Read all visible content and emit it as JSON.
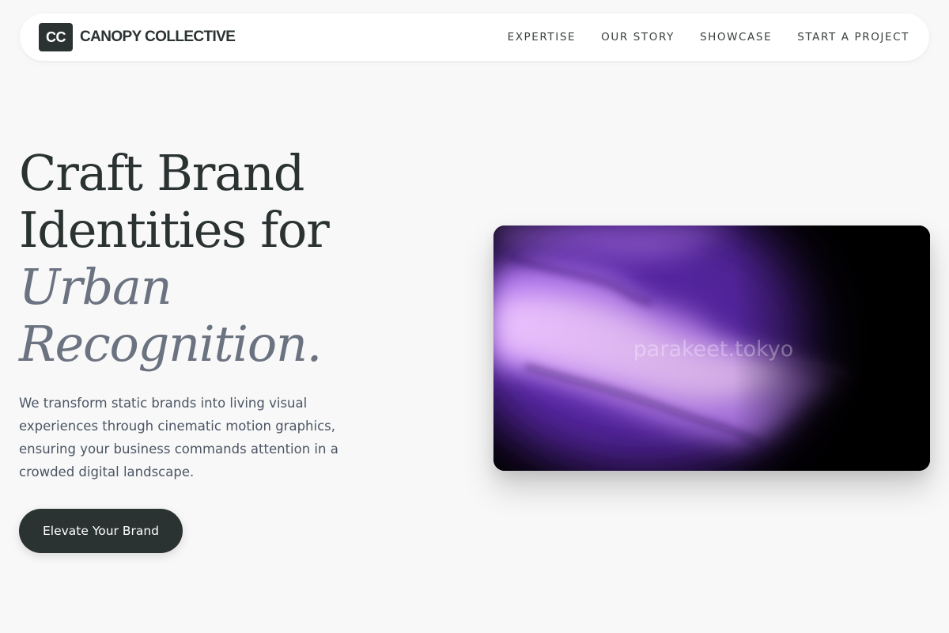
{
  "header": {
    "logo_mark": "CC",
    "brand_name": "CANOPY COLLECTIVE",
    "nav": [
      {
        "label": "EXPERTISE"
      },
      {
        "label": "OUR STORY"
      },
      {
        "label": "SHOWCASE"
      },
      {
        "label": "START A PROJECT"
      }
    ]
  },
  "hero": {
    "title_line1": "Craft Brand",
    "title_line2": "Identities for",
    "title_accent_line1": "Urban",
    "title_accent_line2": "Recognition.",
    "description": "We transform static brands into living visual experiences through cinematic motion graphics, ensuring your business commands attention in a crowded digital landscape.",
    "cta_label": "Elevate Your Brand",
    "media": {
      "watermark": "parakeet.tokyo",
      "colors": {
        "bright": "#f0c8ff",
        "mid": "#b57bf0",
        "deep": "#6b2fc8",
        "background": "#000000"
      }
    }
  },
  "colors": {
    "page_background": "#f8f8f8",
    "primary": "#2b3232",
    "accent_text": "#6b7280"
  }
}
